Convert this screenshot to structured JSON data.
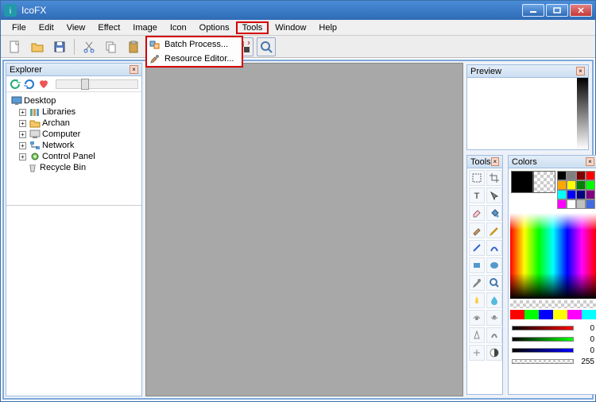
{
  "titlebar": {
    "title": "IcoFX"
  },
  "menubar": {
    "file": "File",
    "edit": "Edit",
    "view": "View",
    "effect": "Effect",
    "image": "Image",
    "icon": "Icon",
    "options": "Options",
    "tools": "Tools",
    "window": "Window",
    "help": "Help"
  },
  "dropdown": {
    "batch": "Batch Process...",
    "resource": "Resource Editor..."
  },
  "panels": {
    "explorer": "Explorer",
    "preview": "Preview",
    "tools": "Tools",
    "colors": "Colors"
  },
  "tree": {
    "desktop": "Desktop",
    "libraries": "Libraries",
    "archan": "Archan",
    "computer": "Computer",
    "network": "Network",
    "control_panel": "Control Panel",
    "recycle_bin": "Recycle Bin"
  },
  "color_sliders": {
    "r": "0",
    "g": "0",
    "b": "0",
    "a": "255"
  },
  "palette": [
    "#000000",
    "#808080",
    "#800000",
    "#ff0000",
    "#ffa500",
    "#ffff00",
    "#008000",
    "#00ff00",
    "#00ffff",
    "#0000ff",
    "#000080",
    "#800080",
    "#ff00ff",
    "#ffffff",
    "#c0c0c0",
    "#4169e1"
  ]
}
